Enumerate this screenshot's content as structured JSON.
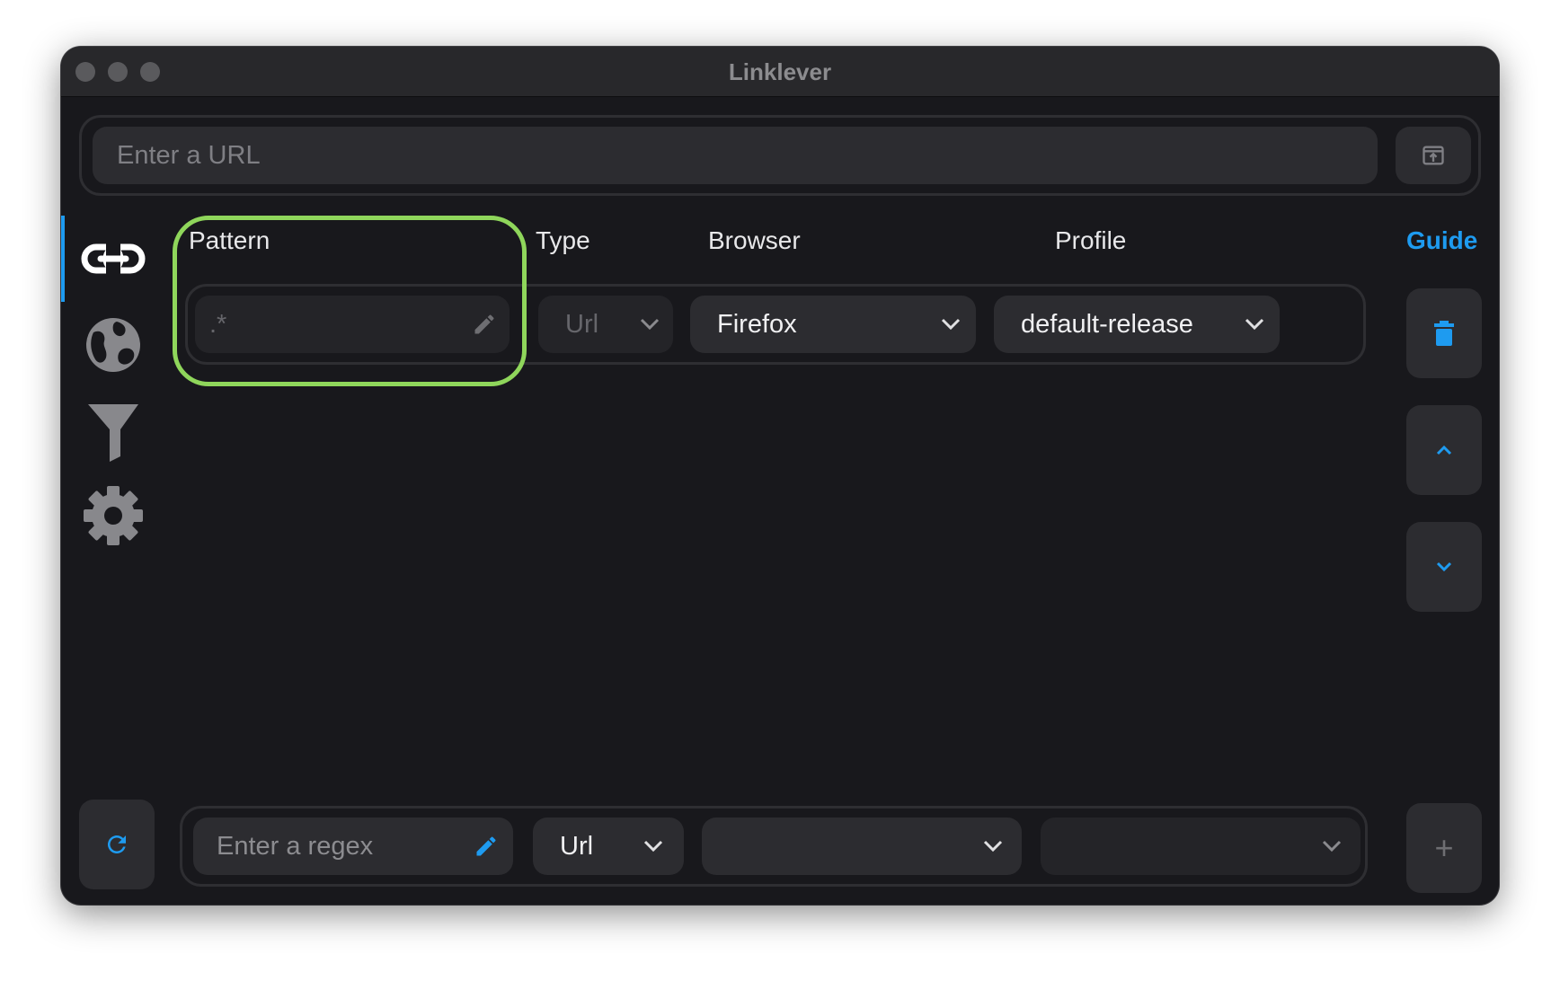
{
  "window": {
    "title": "Linklever"
  },
  "url_bar": {
    "placeholder": "Enter a URL"
  },
  "sidebar": {
    "items": [
      {
        "name": "links",
        "icon": "link-icon",
        "active": true
      },
      {
        "name": "browsers",
        "icon": "globe-icon",
        "active": false
      },
      {
        "name": "filters",
        "icon": "filter-icon",
        "active": false
      },
      {
        "name": "settings",
        "icon": "gear-icon",
        "active": false
      }
    ]
  },
  "table": {
    "headers": {
      "pattern": "Pattern",
      "type": "Type",
      "browser": "Browser",
      "profile": "Profile"
    },
    "guide_label": "Guide",
    "rows": [
      {
        "pattern": ".*",
        "type": "Url",
        "browser": "Firefox",
        "profile": "default-release"
      }
    ]
  },
  "new_rule": {
    "pattern_placeholder": "Enter a regex",
    "type": "Url",
    "browser": "",
    "profile": ""
  },
  "actions": {
    "delete_icon": "trash-icon",
    "move_up_icon": "chevron-up-icon",
    "move_down_icon": "chevron-down-icon",
    "add_label": "+",
    "refresh_icon": "refresh-icon"
  },
  "colors": {
    "accent": "#1e9bf0",
    "highlight": "#8fd65b",
    "background": "#18181c",
    "field": "#2c2c30"
  }
}
